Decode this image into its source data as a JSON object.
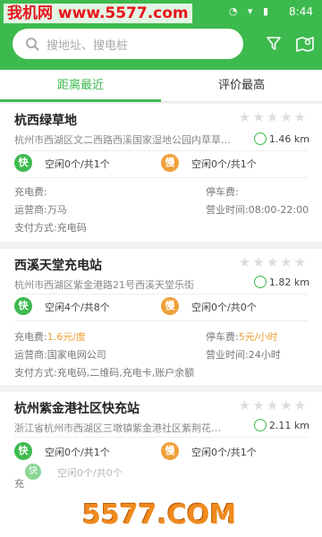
{
  "status_bar": {
    "watermark": "我机网 www.5577.com",
    "time": "8:44",
    "icons": "◔ ▾ ▮"
  },
  "search": {
    "placeholder": "搜地址、搜电桩"
  },
  "tabs": {
    "nearest": "距离最近",
    "top_rated": "评价最高"
  },
  "stations": [
    {
      "name": "杭西绿草地",
      "stars": "★★★★★",
      "address": "杭州市西湖区文二西路西溪国家湿地公园内草草…",
      "distance": "1.46 km",
      "fast_label": "快",
      "fast_slots": "空闲0个/共1个",
      "slow_label": "慢",
      "slow_slots": "空闲0个/共1个",
      "charge_fee": "充电费:",
      "parking_fee": "停车费:",
      "operator": "运营商:万马",
      "hours": "营业时间:08:00-22:00",
      "payment": "支付方式:充电码"
    },
    {
      "name": "西溪天堂充电站",
      "stars": "★★★★★",
      "address": "杭州市西湖区紫金港路21号西溪天堂乐街",
      "distance": "1.82 km",
      "fast_label": "快",
      "fast_slots": "空闲4个/共8个",
      "slow_label": "慢",
      "slow_slots": "空闲0个/共0个",
      "charge_fee_label": "充电费:",
      "charge_fee_value": "1.6元/度",
      "parking_fee_label": "停车费:",
      "parking_fee_value": "5元/小时",
      "operator": "运营商:国家电网公司",
      "hours": "营业时间:24小时",
      "payment": "支付方式:充电码,二维码,充电卡,账户余额"
    },
    {
      "name": "杭州紫金港社区快充站",
      "stars": "★★★★★",
      "address": "浙江省杭州市西湖区三墩镇紫金港社区紫荆花…",
      "distance": "2.11 km",
      "fast_label": "快",
      "fast_slots": "空闲0个/共1个",
      "slow_label": "慢",
      "slow_slots": "空闲0个/共1个",
      "ghost_text": "空闲0个/共0个",
      "charge_fee": "充"
    }
  ],
  "bottom_watermark": "5577.COM"
}
